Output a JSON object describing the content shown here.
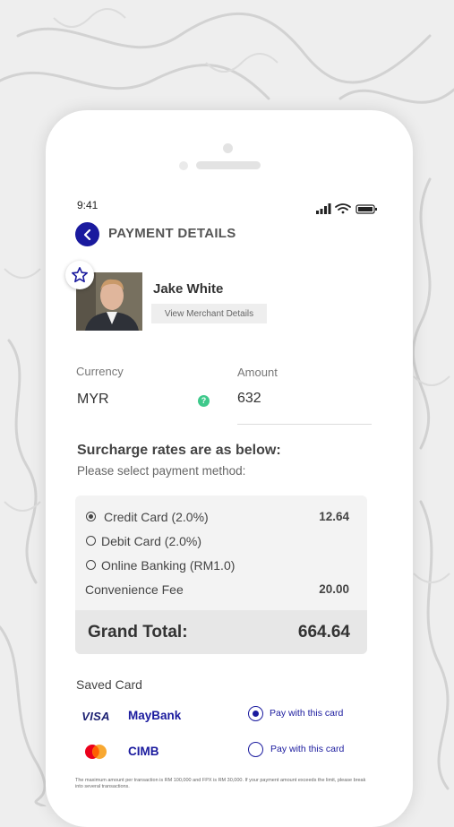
{
  "status_bar": {
    "time": "9:41"
  },
  "header": {
    "title": "PAYMENT DETAILS"
  },
  "merchant": {
    "name": "Jake White",
    "details_button": "View Merchant Details"
  },
  "currency": {
    "label": "Currency",
    "value": "MYR"
  },
  "amount": {
    "label": "Amount",
    "value": "632"
  },
  "surcharge": {
    "heading": "Surcharge rates are as below:",
    "subheading": "Please select payment method:",
    "methods": [
      {
        "label": "Credit Card (2.0%)",
        "value": "12.64",
        "selected": true
      },
      {
        "label": "Debit Card (2.0%)",
        "value": "",
        "selected": false
      },
      {
        "label": "Online Banking (RM1.0)",
        "value": "",
        "selected": false
      }
    ],
    "convenience_fee": {
      "label": "Convenience Fee",
      "value": "20.00"
    },
    "grand_total": {
      "label": "Grand Total:",
      "value": "664.64"
    }
  },
  "saved_cards": {
    "title": "Saved Card",
    "cards": [
      {
        "logo_text": "VISA",
        "bank": "MayBank",
        "pay_label": "Pay with this card",
        "selected": true
      },
      {
        "logo_text": "",
        "bank": "CIMB",
        "pay_label": "Pay with this card",
        "selected": false
      }
    ]
  },
  "disclaimer": "The maximum amount per transaction is RM 100,000 and FPX is RM 30,000. If your payment amount exceeds the limit, please break into several transactions.",
  "colors": {
    "accent": "#1a1a9e",
    "help_icon": "#3ec98b",
    "background": "#eeeeee"
  }
}
